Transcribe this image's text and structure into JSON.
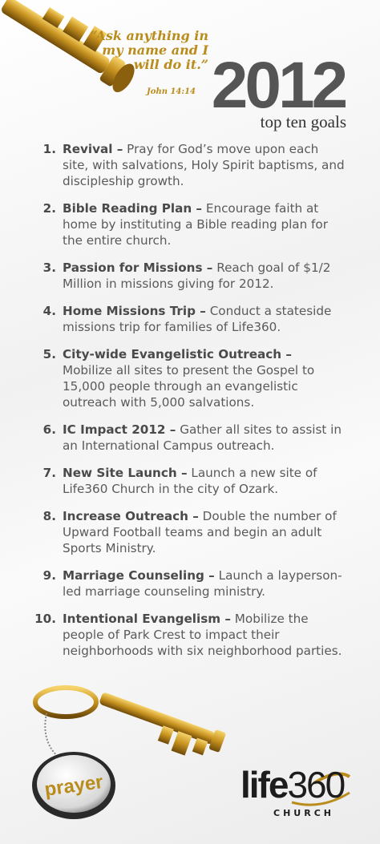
{
  "header": {
    "quote": "“Ask anything in my name and I will do it.”",
    "quote_ref": "John 14:14",
    "year": "2012",
    "subtitle": "top ten goals"
  },
  "goals": [
    {
      "num": "1.",
      "title": "Revival –",
      "text": " Pray for God’s move upon each site, with salvations, Holy Spirit baptisms, and discipleship growth."
    },
    {
      "num": "2.",
      "title": "Bible Reading Plan –",
      "text": " Encourage faith at home by instituting a Bible reading plan for the entire church."
    },
    {
      "num": "3.",
      "title": "Passion for Missions –",
      "text": " Reach goal of $1/2 Million in missions giving for 2012."
    },
    {
      "num": "4.",
      "title": "Home Missions Trip –",
      "text": " Conduct a stateside missions trip for families of Life360."
    },
    {
      "num": "5.",
      "title": "City-wide Evangelistic Outreach –",
      "text": " Mobilize all sites to present the Gospel to 15,000 people through an evangelistic outreach with 5,000 salvations."
    },
    {
      "num": "6.",
      "title": "IC Impact 2012 –",
      "text": " Gather all sites to assist in an International Campus outreach."
    },
    {
      "num": "7.",
      "title": "New Site Launch –",
      "text": " Launch a new site of Life360 Church in the city of Ozark."
    },
    {
      "num": "8.",
      "title": "Increase Outreach –",
      "text": " Double the number of Upward Football teams and begin an adult Sports Ministry."
    },
    {
      "num": "9.",
      "title": "Marriage Counseling –",
      "text": " Launch a layperson-led marriage counseling ministry."
    },
    {
      "num": "10.",
      "title": "Intentional Evangelism –",
      "text": " Mobilize the people of Park Crest to impact their neighborhoods with six neighborhood parties."
    }
  ],
  "tag_text": "prayer",
  "logo": {
    "word": "life",
    "num": "360",
    "church": "CHURCH"
  },
  "colors": {
    "gold": "#b98c1c",
    "text": "#5a5a5a",
    "dark": "#1d1d1d"
  }
}
